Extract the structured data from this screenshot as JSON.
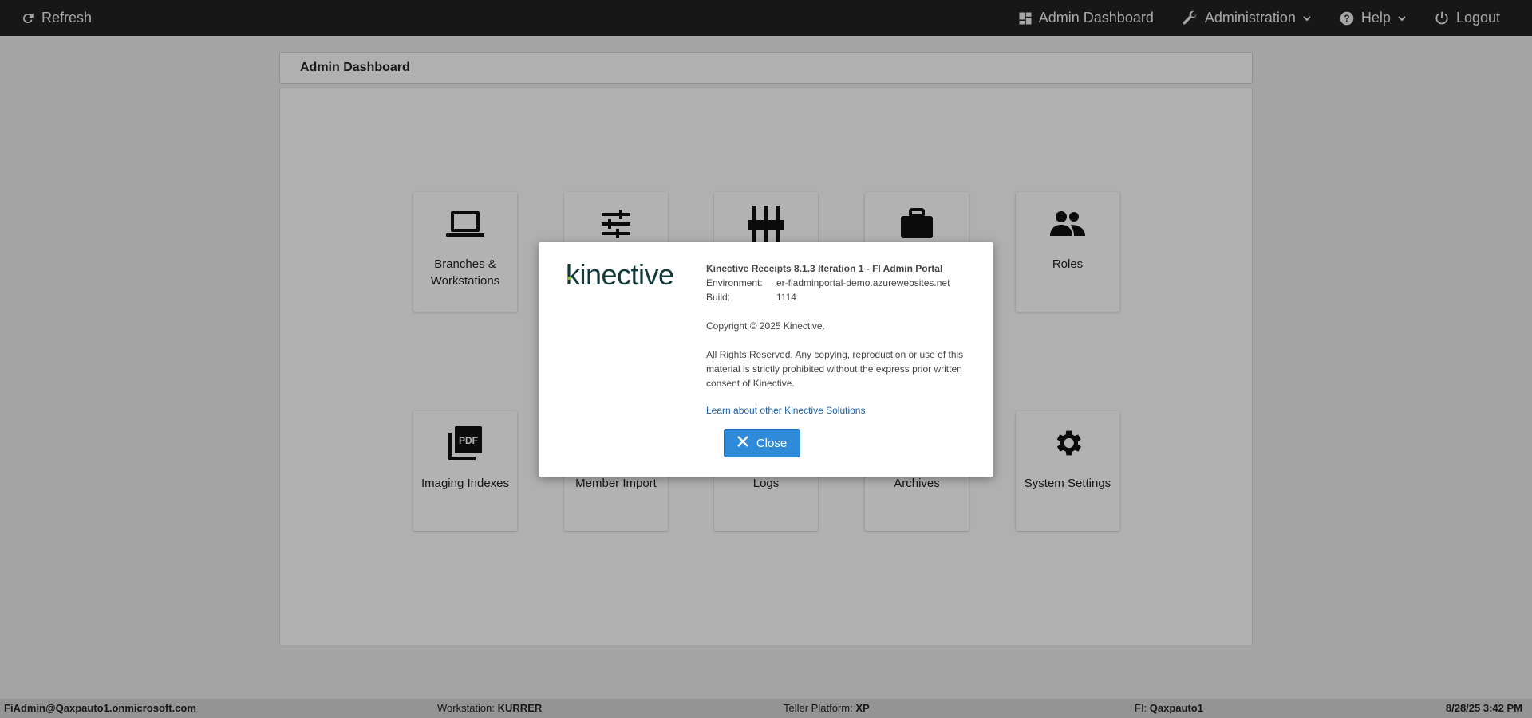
{
  "topbar": {
    "refresh": "Refresh",
    "admin_dashboard": "Admin Dashboard",
    "administration": "Administration",
    "help": "Help",
    "logout": "Logout"
  },
  "panel": {
    "title": "Admin Dashboard"
  },
  "tiles": [
    {
      "label": "Branches & Workstations",
      "icon": "laptop-icon"
    },
    {
      "label": "",
      "icon": "sliders-icon"
    },
    {
      "label": "",
      "icon": "equalizer-icon"
    },
    {
      "label": "",
      "icon": "briefcase-icon"
    },
    {
      "label": "Roles",
      "icon": "people-icon"
    },
    {
      "label": "Imaging Indexes",
      "icon": "pdf-icon"
    },
    {
      "label": "Member Import",
      "icon": ""
    },
    {
      "label": "Logs",
      "icon": ""
    },
    {
      "label": "Archives",
      "icon": ""
    },
    {
      "label": "System Settings",
      "icon": "gear-icon"
    }
  ],
  "modal": {
    "logo": "kinective",
    "title": "Kinective Receipts 8.1.3 Iteration 1 - FI Admin Portal",
    "environment_label": "Environment:",
    "environment_value": "er-fiadminportal-demo.azurewebsites.net",
    "build_label": "Build:",
    "build_value": "1114",
    "copyright": "Copyright © 2025 Kinective.",
    "rights": "All Rights Reserved. Any copying, reproduction or use of this material is strictly prohibited without the express prior written consent of Kinective.",
    "link": "Learn about other Kinective Solutions",
    "close_label": "Close"
  },
  "statusbar": {
    "user": "FiAdmin@Qaxpauto1.onmicrosoft.com",
    "workstation_label": "Workstation:",
    "workstation_value": "KURRER",
    "platform_label": "Teller Platform:",
    "platform_value": "XP",
    "fi_label": "FI:",
    "fi_value": "Qaxpauto1",
    "datetime": "8/28/25 3:42 PM"
  },
  "colors": {
    "topbar": "#222222",
    "primary_button": "#2f8ad9",
    "link": "#1a5ea5",
    "logo_text": "#123a3a",
    "logo_accent": "#8bc53f"
  }
}
